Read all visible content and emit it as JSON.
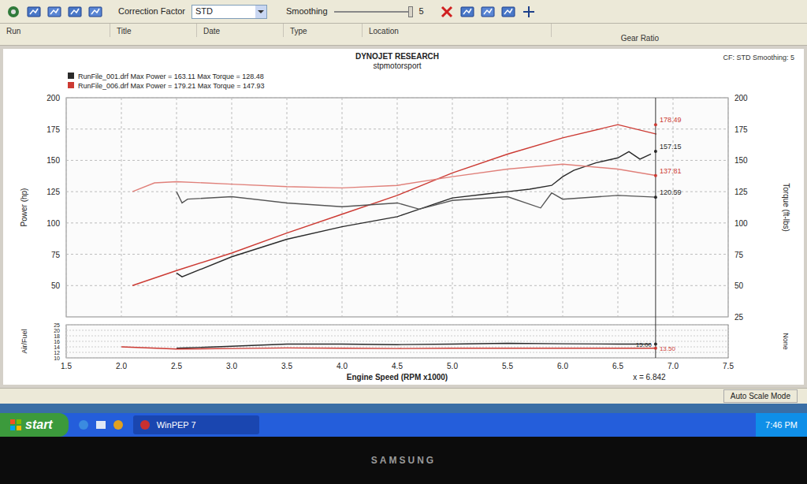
{
  "window": {
    "app": "WinPEP 7"
  },
  "toolbar": {
    "correction_factor_label": "Correction Factor",
    "correction_factor": "STD",
    "smoothing_label": "Smoothing",
    "smoothing_value": "5",
    "smoothing_level": 1
  },
  "columns": [
    "Run",
    "Title",
    "Date",
    "Type",
    "Location",
    "Gear Ratio"
  ],
  "chart": {
    "title": "DYNOJET RESEARCH",
    "subtitle": "stpmotorsport",
    "info": "CF: STD Smoothing: 5",
    "legend": [
      {
        "text": "RunFile_001.drf Max Power = 163.11 Max Torque = 128.48",
        "color": "#2a2a2a"
      },
      {
        "text": "RunFile_006.drf Max Power = 179.21 Max Torque = 147.93",
        "color": "#cc3a33"
      }
    ],
    "y_left": {
      "label": "Power (hp)",
      "ticks": [
        "200",
        "175",
        "150",
        "125",
        "100",
        "75",
        "50"
      ]
    },
    "y_right": {
      "label": "Torque (ft-lbs)",
      "ticks": [
        "200",
        "175",
        "150",
        "125",
        "100",
        "75",
        "50",
        "25"
      ]
    },
    "x_axis": {
      "label": "Engine Speed (RPM x1000)",
      "ticks": [
        "1.5",
        "2.0",
        "2.5",
        "3.0",
        "3.5",
        "4.0",
        "4.5",
        "5.0",
        "5.5",
        "6.0",
        "6.5",
        "7.0",
        "7.5"
      ]
    },
    "afr_axis": {
      "label": "Air/Fuel",
      "ticks": [
        "25",
        "20",
        "18",
        "16",
        "14",
        "12",
        "10"
      ],
      "right_label": "None"
    },
    "series": [
      {
        "axis": "main",
        "color": "#cc3a33",
        "rpm": [
          2.1,
          2.5,
          3.0,
          3.5,
          4.0,
          4.5,
          5.0,
          5.5,
          6.0,
          6.5,
          6.85
        ],
        "values": [
          50,
          62,
          76,
          92,
          107,
          122,
          140,
          155,
          168,
          178.5,
          171
        ]
      },
      {
        "axis": "main",
        "color": "#2a2a2a",
        "rpm": [
          2.5,
          2.55,
          3.0,
          3.5,
          4.0,
          4.5,
          4.6,
          4.8,
          5.0,
          5.3,
          5.5,
          5.7,
          5.9,
          6.0,
          6.1,
          6.3,
          6.5,
          6.6,
          6.7,
          6.8
        ],
        "values": [
          60,
          57,
          73,
          87,
          97,
          105,
          108,
          114,
          120,
          123,
          125,
          127,
          130,
          137,
          142,
          148,
          152,
          157,
          151,
          155
        ]
      },
      {
        "axis": "main",
        "color": "#e0807a",
        "rpm": [
          2.1,
          2.3,
          2.5,
          3.0,
          3.5,
          4.0,
          4.5,
          5.0,
          5.5,
          6.0,
          6.5,
          6.85
        ],
        "values": [
          125,
          132,
          133,
          131,
          129,
          128,
          130,
          137,
          143,
          147,
          143,
          137.8
        ]
      },
      {
        "axis": "main",
        "color": "#555555",
        "rpm": [
          2.5,
          2.55,
          2.6,
          3.0,
          3.5,
          4.0,
          4.5,
          4.7,
          5.0,
          5.5,
          5.8,
          5.9,
          6.0,
          6.5,
          6.85
        ],
        "values": [
          125,
          116,
          119,
          121,
          116,
          113,
          116,
          111,
          118,
          121,
          112,
          124,
          119,
          122,
          120.6
        ]
      },
      {
        "axis": "afr",
        "color": "#2a2a2a",
        "rpm": [
          2.5,
          3.0,
          3.5,
          4.0,
          4.5,
          5.0,
          5.5,
          6.0,
          6.5,
          6.8
        ],
        "values": [
          13.5,
          14.2,
          15,
          15,
          14.8,
          15,
          15.3,
          15.1,
          15,
          15
        ]
      },
      {
        "axis": "afr",
        "color": "#cc3a33",
        "rpm": [
          2.0,
          2.5,
          3.0,
          3.5,
          4.0,
          4.5,
          5.0,
          5.5,
          6.0,
          6.5,
          6.85
        ],
        "values": [
          14,
          13.2,
          13.4,
          13.6,
          13.5,
          13.4,
          13.5,
          13.5,
          13.5,
          13.5,
          13.5
        ]
      }
    ],
    "cursor": {
      "rpm": 6.842,
      "label": "x = 6.842",
      "readouts": [
        {
          "text": "178.49",
          "value": 178.49,
          "axis": "main",
          "color": "#cc3a33"
        },
        {
          "text": "157.15",
          "value": 157.15,
          "axis": "main",
          "color": "#2a2a2a"
        },
        {
          "text": "137.81",
          "value": 137.81,
          "axis": "main",
          "color": "#cc3a33"
        },
        {
          "text": "120.59",
          "value": 120.59,
          "axis": "main",
          "color": "#2a2a2a"
        },
        {
          "text": "15.00",
          "value": 15.0,
          "axis": "afr",
          "color": "#2a2a2a"
        },
        {
          "text": "13.50",
          "value": 13.5,
          "axis": "afr",
          "color": "#cc3a33"
        }
      ]
    }
  },
  "status_bar": {
    "mode": "Auto Scale Mode"
  },
  "taskbar": {
    "start": "start",
    "tasks": [
      {
        "label": "WinPEP 7",
        "selected": true
      }
    ],
    "clock": "7:46 PM"
  },
  "monitor": {
    "brand": "SAMSUNG"
  }
}
